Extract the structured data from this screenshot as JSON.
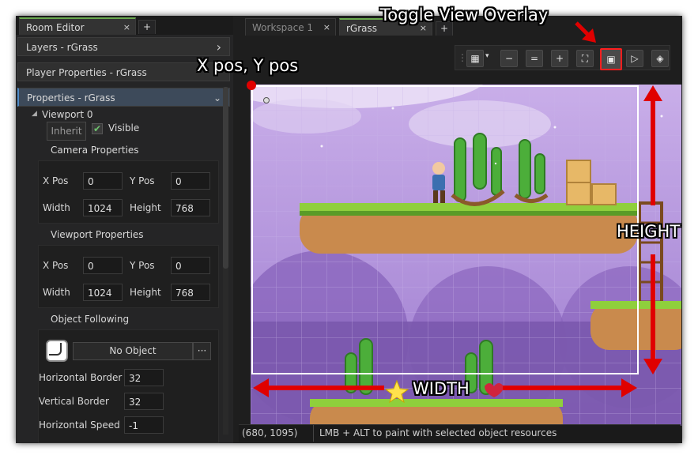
{
  "left_tabs": [
    {
      "label": "Room Editor",
      "close": "×"
    },
    {
      "label": "+"
    }
  ],
  "sections": {
    "layers": {
      "label": "Layers - rGrass",
      "chevron": "›"
    },
    "player": {
      "label": "Player Properties - rGrass"
    },
    "properties": {
      "label": "Properties - rGrass",
      "chevron": "⌄"
    }
  },
  "viewport": {
    "title": "Viewport 0",
    "inherit_label": "Inherit",
    "visible_label": "Visible",
    "visible_checked": true,
    "camera": {
      "title": "Camera Properties",
      "xpos_label": "X Pos",
      "xpos": "0",
      "ypos_label": "Y Pos",
      "ypos": "0",
      "width_label": "Width",
      "width": "1024",
      "height_label": "Height",
      "height": "768"
    },
    "viewport_props": {
      "title": "Viewport Properties",
      "xpos_label": "X Pos",
      "xpos": "0",
      "ypos_label": "Y Pos",
      "ypos": "0",
      "width_label": "Width",
      "width": "1024",
      "height_label": "Height",
      "height": "768"
    },
    "following": {
      "title": "Object Following",
      "object_label": "No Object",
      "more_label": "···",
      "hborder_label": "Horizontal Border",
      "hborder": "32",
      "vborder_label": "Vertical Border",
      "vborder": "32",
      "hspeed_label": "Horizontal Speed",
      "hspeed": "-1"
    }
  },
  "right_tabs": [
    {
      "label": "Workspace 1",
      "close": "×"
    },
    {
      "label": "rGrass",
      "close": "×"
    },
    {
      "label": "+"
    }
  ],
  "toolbar": {
    "grip": "⋮",
    "grid": "▦",
    "grid_drop": "▾",
    "zoom_out": "−",
    "zoom_reset": "=",
    "zoom_in": "+",
    "fit": "⛶",
    "overlay": "▣",
    "play": "▷",
    "layers": "◈"
  },
  "status": {
    "coords": "(680, 1095)",
    "hint": "LMB + ALT to paint with selected object resources"
  },
  "annotations": {
    "toggle_overlay": "Toggle View Overlay",
    "xy_pos": "X pos, Y pos",
    "height": "HEIGHT",
    "width": "WIDTH"
  },
  "colors": {
    "accent_red": "#ff1e1e",
    "tab_active": "#6aa84f",
    "canvas_bg": "#b18fd8"
  }
}
